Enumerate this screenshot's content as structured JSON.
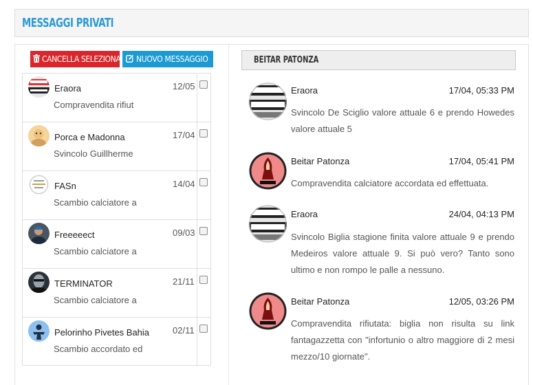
{
  "page": {
    "title": "MESSAGGI PRIVATI"
  },
  "toolbar": {
    "delete_label": "CANCELLA SELEZIONATI",
    "new_label": "NUOVO MESSAGGIO"
  },
  "conversations": [
    {
      "name": "Eraora",
      "date": "12/05",
      "preview": "Compravendita rifiut",
      "avatar": "eraora-avatar"
    },
    {
      "name": "Porca e Madonna",
      "date": "17/04",
      "preview": "Svincolo Guillherme",
      "avatar": "cartoon-avatar"
    },
    {
      "name": "FASn",
      "date": "14/04",
      "preview": "Scambio calciatore a",
      "avatar": "badge-avatar"
    },
    {
      "name": "Freeeeect",
      "date": "09/03",
      "preview": "Scambio calciatore a",
      "avatar": "photo-avatar"
    },
    {
      "name": "TERMINATOR",
      "date": "21/11",
      "preview": "Scambio calciatore a",
      "avatar": "terminator-avatar"
    },
    {
      "name": "Pelorinho Pivetes Bahia",
      "date": "02/11",
      "preview": "Scambio accordato ed",
      "avatar": "figure-avatar"
    }
  ],
  "thread": {
    "title": "BEITAR PATONZA",
    "messages": [
      {
        "author": "Eraora",
        "time": "17/04, 05:33 PM",
        "body": "Svincolo De Sciglio valore attuale 6 e prendo Howedes valore attuale 5",
        "avatar": "eraora-avatar"
      },
      {
        "author": "Beitar Patonza",
        "time": "17/04, 05:41 PM",
        "body": "Compravendita calciatore accordata ed effettuata.",
        "avatar": "beitar-avatar"
      },
      {
        "author": "Eraora",
        "time": "24/04, 04:13 PM",
        "body": "Svincolo Biglia stagione finita valore attuale 9 e prendo Medeiros valore attuale 9. Si può vero? Tanto sono ultimo e non rompo le palle a nessuno.",
        "avatar": "eraora-avatar"
      },
      {
        "author": "Beitar Patonza",
        "time": "12/05, 03:26 PM",
        "body": "Compravendita rifiutata: biglia non risulta su link fantagazzetta con \"infortunio o altro maggiore di 2 mesi mezzo/10 giornate\".",
        "avatar": "beitar-avatar"
      }
    ]
  },
  "colors": {
    "title": "#2a9ad6",
    "delete_button": "#d9262b",
    "new_button": "#1b9ad3"
  }
}
